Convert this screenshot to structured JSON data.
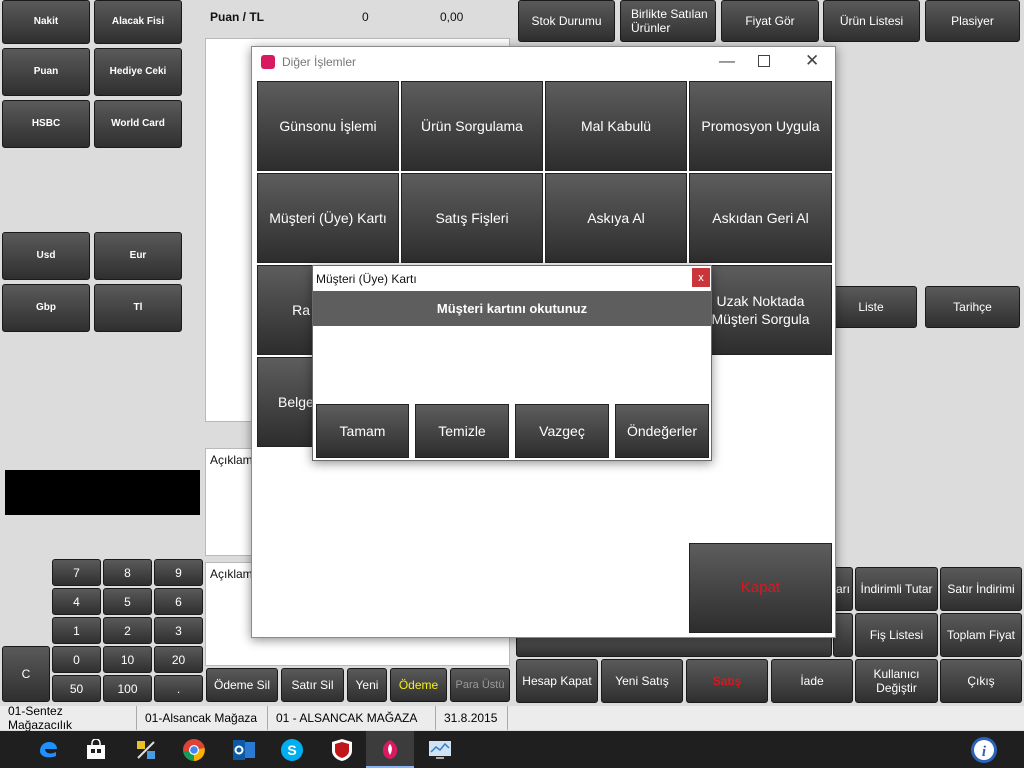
{
  "payment_left": {
    "row1": [
      "Nakit",
      "Alacak Fisi"
    ],
    "row2": [
      "Puan",
      "Hediye Ceki"
    ],
    "row3": [
      "HSBC",
      "World Card"
    ],
    "row4": [
      "Usd",
      "Eur"
    ],
    "row5": [
      "Gbp",
      "Tl"
    ]
  },
  "points": {
    "label": "Puan / TL",
    "count": "0",
    "amount": "0,00"
  },
  "top_right": [
    "Stok Durumu",
    "Birlikte Satılan Ürünler",
    "Fiyat Gör",
    "Ürün Listesi",
    "Plasiyer"
  ],
  "mid_right": [
    "Liste",
    "Tarihçe"
  ],
  "aciklama_partial": "Açıklam",
  "numpad": {
    "keys": [
      "7",
      "8",
      "9",
      "4",
      "5",
      "6",
      "1",
      "2",
      "3",
      "0",
      "10",
      "20",
      "50",
      "100",
      "."
    ],
    "clear": "C"
  },
  "bottom_actions": [
    "Ödeme Sil",
    "Satır Sil",
    "Yeni",
    "Ödeme",
    "Para Üstü"
  ],
  "bottom_right_row1": [
    "Hesap Kapat",
    "Yeni Satış",
    "Satış",
    "İade",
    "Kullanıcı Değiştir",
    "Çıkış"
  ],
  "bottom_right_row2": [
    "Fiş Listesi",
    "Toplam Fiyat"
  ],
  "bottom_right_row3": [
    "İndirimli Tutar",
    "Satır İndirimi"
  ],
  "partial_labels": {
    "ari": "arı"
  },
  "status_bar": [
    "01-Sentez Mağazacılık",
    "01-Alsancak Mağaza",
    "01 - ALSANCAK MAĞAZA",
    "31.8.2015"
  ],
  "other_ops_window": {
    "title": "Diğer İşlemler",
    "buttons": [
      "Günsonu İşlemi",
      "Ürün Sorgulama",
      "Mal Kabulü",
      "Promosyon Uygula",
      "Müşteri (Üye) Kartı",
      "Satış Fişleri",
      "Askıya Al",
      "Askıdan Geri Al",
      "Uzak Noktada Müşteri Sorgula"
    ],
    "partial_ra": "Ra",
    "partial_belge": "Belge",
    "close_label": "Kapat"
  },
  "member_dialog": {
    "title": "Müşteri (Üye) Kartı",
    "close": "x",
    "header": "Müşteri kartını okutunuz",
    "buttons": [
      "Tamam",
      "Temizle",
      "Vazgeç",
      "Öndeğerler"
    ]
  },
  "taskbar_icons": [
    "start-icon",
    "edge-icon",
    "store-icon",
    "tools-icon",
    "chrome-icon",
    "outlook-icon",
    "skype-icon",
    "mcafee-icon",
    "app-icon",
    "monitor-icon",
    "help-icon"
  ],
  "colors": {
    "accent_red": "#e0151b",
    "highlight_yellow": "#f5f01a",
    "title_pink": "#d81b60"
  }
}
